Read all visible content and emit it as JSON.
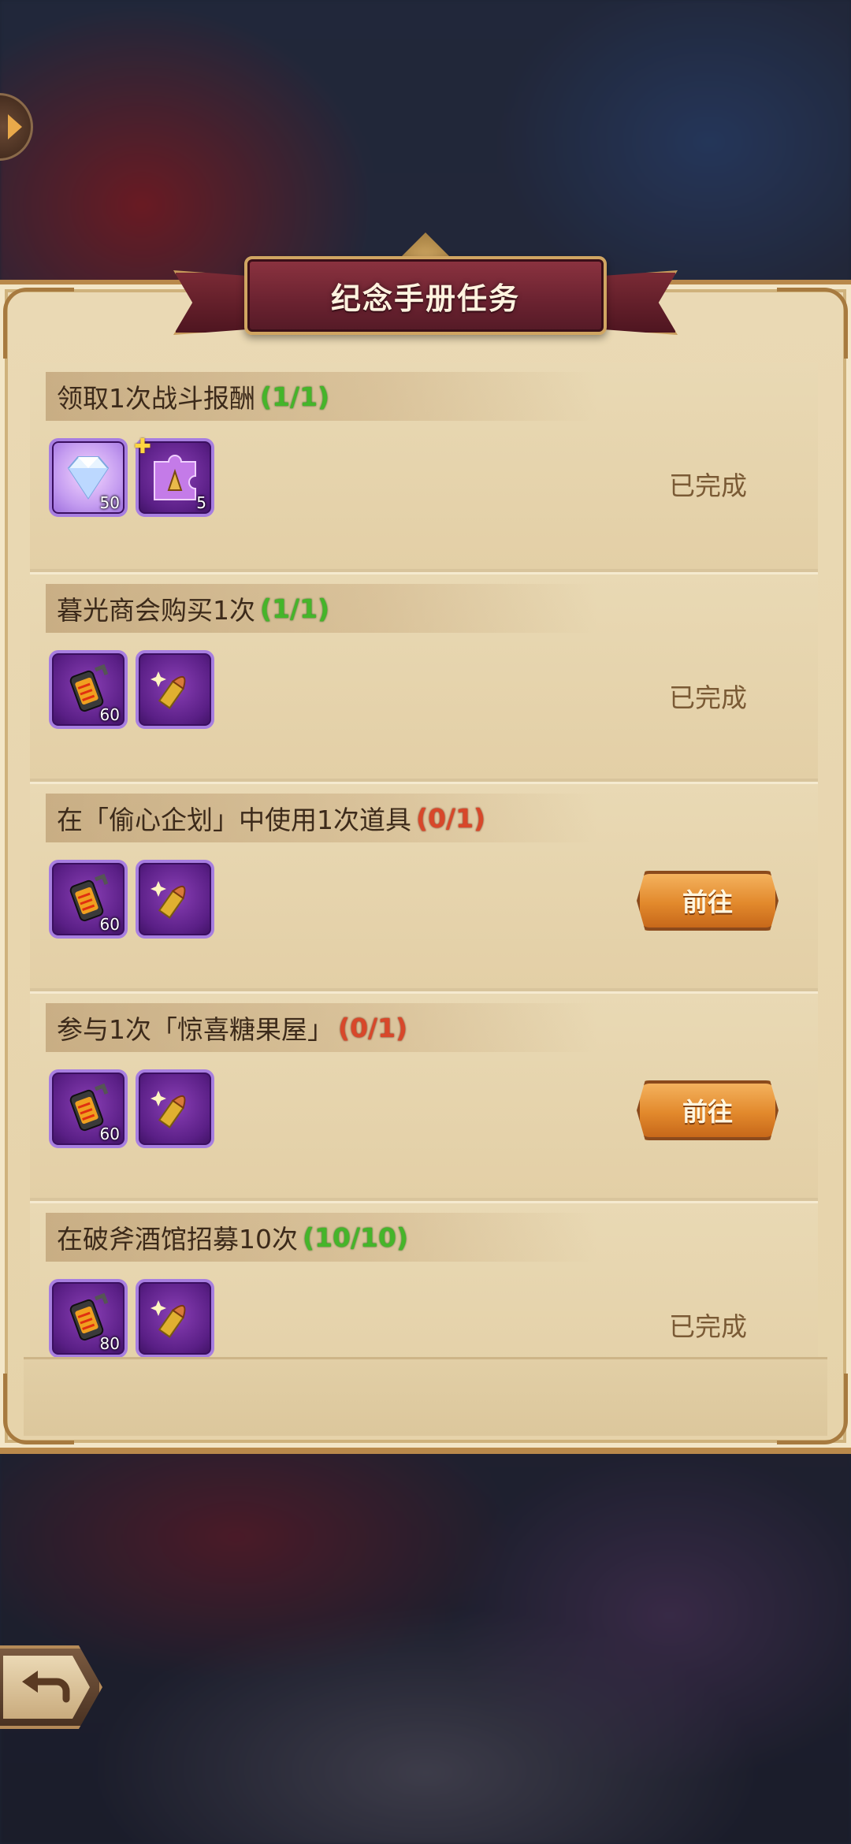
{
  "header": {
    "title": "纪念手册任务"
  },
  "tasks": [
    {
      "name": "领取1次战斗报酬",
      "progress": "(1/1)",
      "state": "done",
      "status_label": "已完成",
      "rewards": [
        {
          "icon": "diamond-icon",
          "qty": "50"
        },
        {
          "icon": "puzzle-fragment-icon",
          "qty": "5"
        }
      ]
    },
    {
      "name": "暮光商会购买1次",
      "progress": "(1/1)",
      "state": "done",
      "status_label": "已完成",
      "rewards": [
        {
          "icon": "fuel-canister-icon",
          "qty": "60"
        },
        {
          "icon": "bullet-icon",
          "qty": ""
        }
      ]
    },
    {
      "name": "在「偷心企划」中使用1次道具",
      "progress": "(0/1)",
      "state": "todo",
      "status_label": "前往",
      "rewards": [
        {
          "icon": "fuel-canister-icon",
          "qty": "60"
        },
        {
          "icon": "bullet-icon",
          "qty": ""
        }
      ]
    },
    {
      "name": "参与1次「惊喜糖果屋」",
      "progress": "(0/1)",
      "state": "todo",
      "status_label": "前往",
      "rewards": [
        {
          "icon": "fuel-canister-icon",
          "qty": "60"
        },
        {
          "icon": "bullet-icon",
          "qty": ""
        }
      ]
    },
    {
      "name": "在破斧酒馆招募10次",
      "progress": "(10/10)",
      "state": "done",
      "status_label": "已完成",
      "rewards": [
        {
          "icon": "fuel-canister-icon",
          "qty": "80"
        },
        {
          "icon": "bullet-icon",
          "qty": ""
        }
      ]
    }
  ],
  "colors": {
    "done": "#45b52a",
    "todo": "#d8472a",
    "accent": "#e2892c",
    "banner": "#6a2230"
  }
}
